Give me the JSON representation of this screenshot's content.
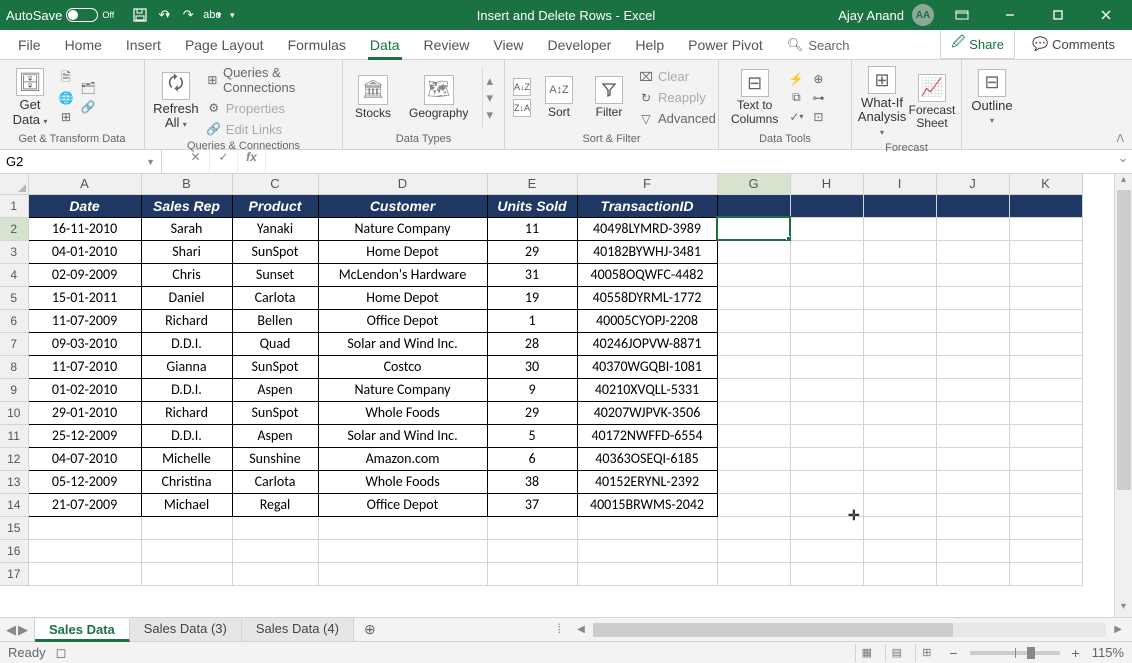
{
  "titlebar": {
    "autosave_label": "AutoSave",
    "autosave_state": "Off",
    "doc_title": "Insert and Delete Rows  -  Excel",
    "user_name": "Ajay Anand",
    "user_initials": "AA"
  },
  "menubar": {
    "tabs": [
      "File",
      "Home",
      "Insert",
      "Page Layout",
      "Formulas",
      "Data",
      "Review",
      "View",
      "Developer",
      "Help",
      "Power Pivot"
    ],
    "selected": "Data",
    "search_label": "Search",
    "share_label": "Share",
    "comments_label": "Comments"
  },
  "ribbon": {
    "groups": {
      "get_transform": {
        "big": "Get\nData",
        "name": "Get & Transform Data"
      },
      "queries": {
        "refresh": "Refresh\nAll",
        "q1": "Queries & Connections",
        "q2": "Properties",
        "q3": "Edit Links",
        "name": "Queries & Connections"
      },
      "datatypes": {
        "stocks": "Stocks",
        "geo": "Geography",
        "name": "Data Types"
      },
      "sortfilter": {
        "sort": "Sort",
        "filter": "Filter",
        "clear": "Clear",
        "reapply": "Reapply",
        "advanced": "Advanced",
        "name": "Sort & Filter"
      },
      "datatools": {
        "ttc": "Text to\nColumns",
        "name": "Data Tools"
      },
      "forecast": {
        "whatif": "What-If\nAnalysis",
        "sheet": "Forecast\nSheet",
        "name": "Forecast"
      },
      "outline": {
        "label": "Outline"
      }
    }
  },
  "namebox": "G2",
  "columns_shown": [
    "A",
    "B",
    "C",
    "D",
    "E",
    "F",
    "G",
    "H",
    "I",
    "J",
    "K"
  ],
  "active_col": "G",
  "active_row": 2,
  "table": {
    "headers": {
      "A": "Date",
      "B": "Sales Rep",
      "C": "Product",
      "D": "Customer",
      "E": "Units Sold",
      "F": "TransactionID"
    },
    "rows": [
      {
        "A": "16-11-2010",
        "B": "Sarah",
        "C": "Yanaki",
        "D": "Nature Company",
        "E": "11",
        "F": "40498LYMRD-3989"
      },
      {
        "A": "04-01-2010",
        "B": "Shari",
        "C": "SunSpot",
        "D": "Home Depot",
        "E": "29",
        "F": "40182BYWHJ-3481"
      },
      {
        "A": "02-09-2009",
        "B": "Chris",
        "C": "Sunset",
        "D": "McLendon's Hardware",
        "E": "31",
        "F": "40058OQWFC-4482"
      },
      {
        "A": "15-01-2011",
        "B": "Daniel",
        "C": "Carlota",
        "D": "Home Depot",
        "E": "19",
        "F": "40558DYRML-1772"
      },
      {
        "A": "11-07-2009",
        "B": "Richard",
        "C": "Bellen",
        "D": "Office Depot",
        "E": "1",
        "F": "40005CYOPJ-2208"
      },
      {
        "A": "09-03-2010",
        "B": "D.D.I.",
        "C": "Quad",
        "D": "Solar and Wind Inc.",
        "E": "28",
        "F": "40246JOPVW-8871"
      },
      {
        "A": "11-07-2010",
        "B": "Gianna",
        "C": "SunSpot",
        "D": "Costco",
        "E": "30",
        "F": "40370WGQBI-1081"
      },
      {
        "A": "01-02-2010",
        "B": "D.D.I.",
        "C": "Aspen",
        "D": "Nature Company",
        "E": "9",
        "F": "40210XVQLL-5331"
      },
      {
        "A": "29-01-2010",
        "B": "Richard",
        "C": "SunSpot",
        "D": "Whole Foods",
        "E": "29",
        "F": "40207WJPVK-3506"
      },
      {
        "A": "25-12-2009",
        "B": "D.D.I.",
        "C": "Aspen",
        "D": "Solar and Wind Inc.",
        "E": "5",
        "F": "40172NWFFD-6554"
      },
      {
        "A": "04-07-2010",
        "B": "Michelle",
        "C": "Sunshine",
        "D": "Amazon.com",
        "E": "6",
        "F": "40363OSEQI-6185"
      },
      {
        "A": "05-12-2009",
        "B": "Christina",
        "C": "Carlota",
        "D": "Whole Foods",
        "E": "38",
        "F": "40152ERYNL-2392"
      },
      {
        "A": "21-07-2009",
        "B": "Michael",
        "C": "Regal",
        "D": "Office Depot",
        "E": "37",
        "F": "40015BRWMS-2042"
      }
    ]
  },
  "sheet_tabs": [
    "Sales Data",
    "Sales Data (3)",
    "Sales Data (4)"
  ],
  "sheet_active": 0,
  "statusbar": {
    "left": "Ready",
    "rec": "",
    "zoom": "115%"
  }
}
